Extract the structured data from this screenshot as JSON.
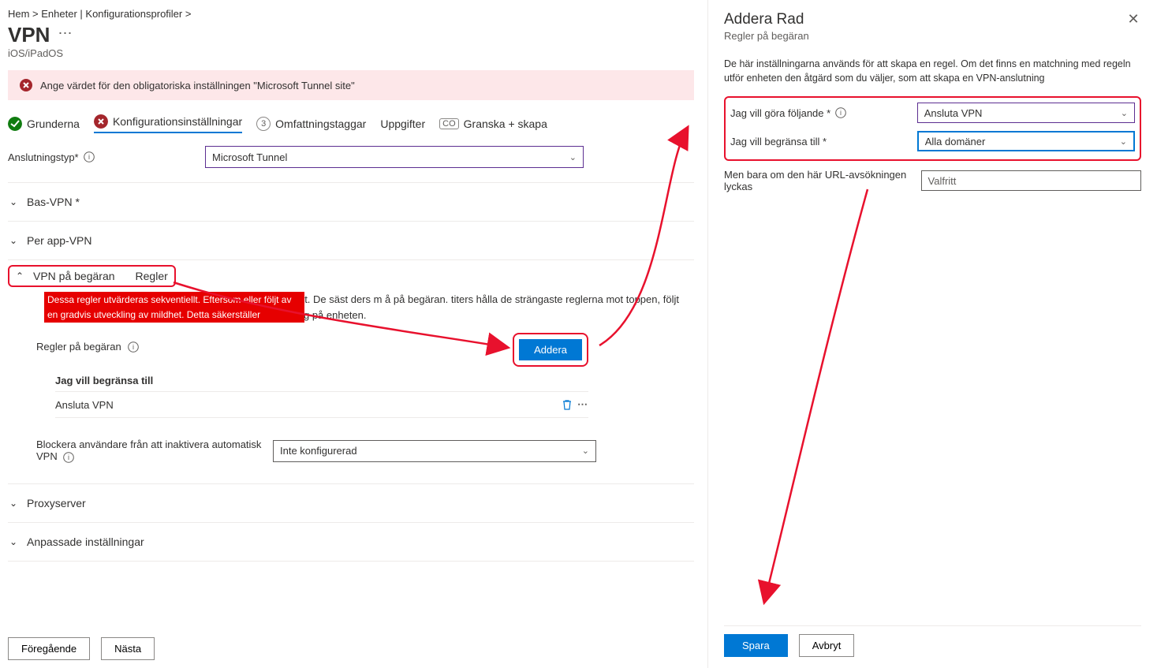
{
  "breadcrumb": "Hem >   Enheter | Konfigurationsprofiler >",
  "pageTitle": "VPN",
  "ellipsis": "⋯",
  "subtitle": "iOS/iPadOS",
  "alert": "Ange värdet för den obligatoriska inställningen \"Microsoft Tunnel site\"",
  "steps": {
    "s1": "Grunderna",
    "s2": "Konfigurationsinställningar",
    "s3num": "3",
    "s3": "Omfattningstaggar",
    "s4": "Uppgifter",
    "s5pre": "CO",
    "s5": "Granska + skapa"
  },
  "connType": {
    "label": "Anslutningstyp*",
    "value": "Microsoft Tunnel"
  },
  "sections": {
    "base": "Bas-VPN *",
    "perapp": "Per app-VPN",
    "ondemand": "VPN på begäran",
    "ondemandSuffix": "Regler",
    "proxy": "Proxyserver",
    "custom": "Anpassade inställningar"
  },
  "ruleDescHighlight": "Dessa regler utvärderas sekventiellt. Eftersom eller följt av en gradvis utveckling av mildhet. Detta säkerställer",
  "ruleDescBg": "Dessa regler utvärderas sekventiellt. Eftersom elldhet. De säst ders m å på begäran. titers hålla de strängaste reglerna mot toppen, följt av en gradvis utveckling av miTule e korrekt värdering på enheten.",
  "rulesLabel": "Regler på begäran",
  "addBtn": "Addera",
  "ruleTable": {
    "header": "Jag vill begränsa till",
    "row1": "Ansluta VPN"
  },
  "block": {
    "label": "Blockera användare från att inaktivera automatisk VPN",
    "value": "Inte konfigurerad"
  },
  "footer": {
    "prev": "Föregående",
    "next": "Nästa"
  },
  "panel": {
    "title": "Addera  Rad",
    "sub": "Regler på begäran",
    "desc": "De här inställningarna används för att skapa en regel. Om det finns en matchning med regeln utför enheten den åtgärd som du väljer, som att skapa en VPN-anslutning",
    "f1": {
      "label": "Jag vill göra följande *",
      "value": "Ansluta VPN"
    },
    "f2": {
      "label": "Jag vill begränsa till *",
      "value": "Alla domäner"
    },
    "f3": {
      "label": "Men bara om den här URL-avsökningen lyckas",
      "value": "Valfritt"
    },
    "save": "Spara",
    "cancel": "Avbryt"
  }
}
